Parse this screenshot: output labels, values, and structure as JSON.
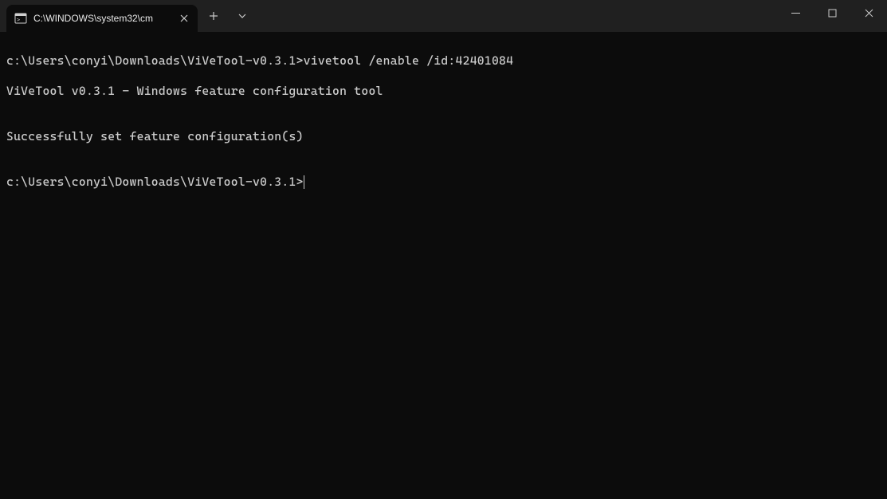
{
  "tab": {
    "title": "C:\\WINDOWS\\system32\\cm"
  },
  "terminal": {
    "line1_prompt": "c:\\Users\\conyi\\Downloads\\ViVeTool-v0.3.1>",
    "line1_cmd": "vivetool /enable /id:42401084",
    "line2": "ViVeTool v0.3.1 - Windows feature configuration tool",
    "line3": "",
    "line4": "Successfully set feature configuration(s)",
    "line5": "",
    "line6_prompt": "c:\\Users\\conyi\\Downloads\\ViVeTool-v0.3.1>"
  }
}
